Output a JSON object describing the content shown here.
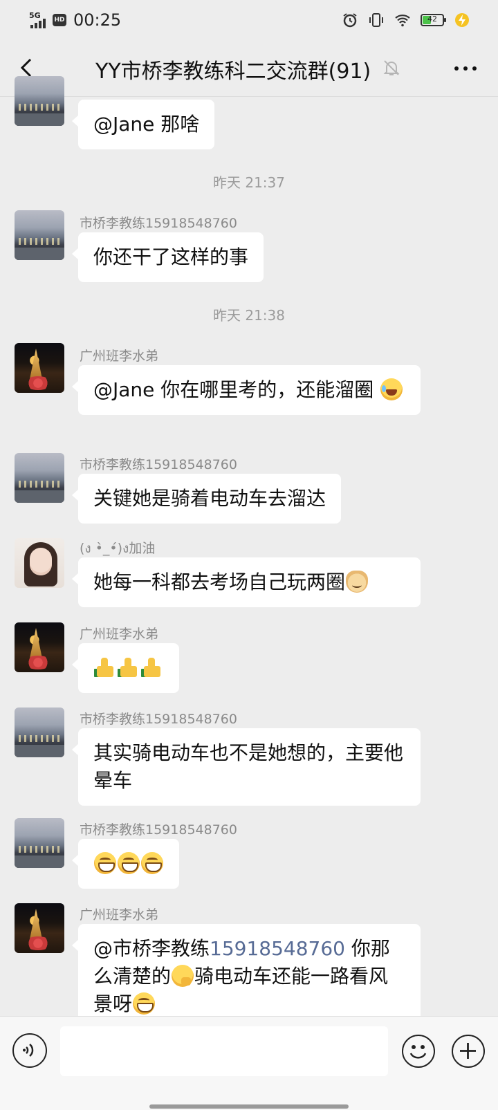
{
  "status_bar": {
    "network": "5G",
    "hd": "HD",
    "time": "00:25",
    "battery": "42"
  },
  "header": {
    "title": "YY市桥李教练科二交流群(91)"
  },
  "messages": [
    {
      "text_before": "@Jane  那啥"
    },
    {
      "timestamp": "昨天 21:37"
    },
    {
      "sender": "市桥李教练15918548760",
      "text": "你还干了这样的事"
    },
    {
      "timestamp": "昨天 21:38"
    },
    {
      "sender": "广州班李水弟",
      "text": "@Jane  你在哪里考的，还能溜圈",
      "emoji": "laugh-cry"
    },
    {
      "sender": "市桥李教练15918548760",
      "text": "关键她是骑着电动车去溜达"
    },
    {
      "sender": "(ง •̀_•́)ง加油",
      "text": "她每一科都去考场自己玩两圈",
      "emoji": "doge"
    },
    {
      "sender": "广州班李水弟",
      "emoji": "thumbs-up"
    },
    {
      "sender": "市桥李教练15918548760",
      "text": "其实骑电动车也不是她想的，主要他晕车"
    },
    {
      "sender": "市桥李教练15918548760",
      "emoji": "grin"
    },
    {
      "sender": "广州班李水弟",
      "mention": "@市桥李教练",
      "phone": "15918548760",
      "text_a": " 你那么清楚的",
      "text_b": "骑电动车还能一路看风景呀"
    }
  ],
  "input": {
    "placeholder": ""
  }
}
